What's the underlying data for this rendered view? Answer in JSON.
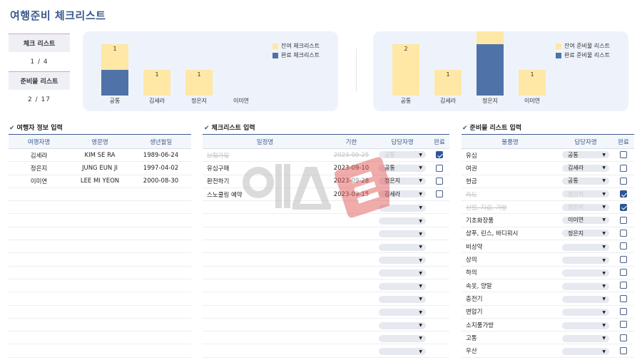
{
  "title": "여행준비 체크리스트",
  "stats": {
    "checklist_label": "체크 리스트",
    "checklist_value": "1 / 4",
    "supplies_label": "준비물 리스트",
    "supplies_value": "2 / 17"
  },
  "colors": {
    "remaining": "#ffe8a6",
    "done": "#4f73a8",
    "accent": "#3b5a8c"
  },
  "chart_data": [
    {
      "type": "bar",
      "categories": [
        "공통",
        "김세라",
        "정은지",
        "이미연"
      ],
      "series": [
        {
          "name": "완료 체크리스트",
          "values": [
            1,
            0,
            0,
            0
          ]
        },
        {
          "name": "잔여 체크리스트",
          "values": [
            1,
            1,
            1,
            0
          ]
        }
      ],
      "labels": [
        "1",
        "1",
        "1",
        ""
      ],
      "stacked": true,
      "legend_position": "top-right"
    },
    {
      "type": "bar",
      "categories": [
        "공통",
        "김세라",
        "정은지",
        "이미연"
      ],
      "series": [
        {
          "name": "완료 준비물 리스트",
          "values": [
            0,
            0,
            2,
            0
          ]
        },
        {
          "name": "잔여 준비물 리스트",
          "values": [
            2,
            1,
            1,
            1
          ]
        }
      ],
      "labels": [
        "2",
        "1",
        "1",
        "1"
      ],
      "stacked": true,
      "legend_position": "top-right"
    }
  ],
  "travelers": {
    "title": "여행자 정보 입력",
    "headers": [
      "여행자명",
      "영문명",
      "생년월일"
    ],
    "rows": [
      [
        "김세라",
        "KIM SE RA",
        "1989-06-24"
      ],
      [
        "정은지",
        "JUNG EUN JI",
        "1997-04-02"
      ],
      [
        "이미연",
        "LEE MI YEON",
        "2000-08-30"
      ]
    ]
  },
  "checklist": {
    "title": "체크리스트 입력",
    "headers": [
      "일정명",
      "기한",
      "담당자명",
      "완료"
    ],
    "rows": [
      {
        "name": "보험가입",
        "date": "2023-09-25",
        "owner": "공통",
        "done": true
      },
      {
        "name": "유심구매",
        "date": "2023-09-10",
        "owner": "공통",
        "done": false
      },
      {
        "name": "환전하기",
        "date": "2023-09-28",
        "owner": "정은지",
        "done": false
      },
      {
        "name": "스노쿨링 예약",
        "date": "2023-09-15",
        "owner": "김세라",
        "done": false
      }
    ]
  },
  "supplies": {
    "title": "준비물 리스트 입력",
    "headers": [
      "물품명",
      "담당자명",
      "완료"
    ],
    "rows": [
      {
        "name": "유심",
        "owner": "공통",
        "done": false
      },
      {
        "name": "여권",
        "owner": "김세라",
        "done": false
      },
      {
        "name": "현금",
        "owner": "공통",
        "done": false
      },
      {
        "name": "카드",
        "owner": "정은지",
        "done": true
      },
      {
        "name": "신발, 지갑, 가방",
        "owner": "정은지",
        "done": true
      },
      {
        "name": "기초화장품",
        "owner": "이미연",
        "done": false
      },
      {
        "name": "샴푸, 린스, 바디워시",
        "owner": "정은지",
        "done": false
      },
      {
        "name": "비상약",
        "owner": "",
        "done": false
      },
      {
        "name": "상의",
        "owner": "",
        "done": false
      },
      {
        "name": "하의",
        "owner": "",
        "done": false
      },
      {
        "name": "속옷, 양말",
        "owner": "",
        "done": false
      },
      {
        "name": "충전기",
        "owner": "",
        "done": false
      },
      {
        "name": "변압기",
        "owner": "",
        "done": false
      },
      {
        "name": "소지품가방",
        "owner": "",
        "done": false
      },
      {
        "name": "고통",
        "owner": "",
        "done": false
      },
      {
        "name": "우산",
        "owner": "",
        "done": false
      }
    ]
  }
}
